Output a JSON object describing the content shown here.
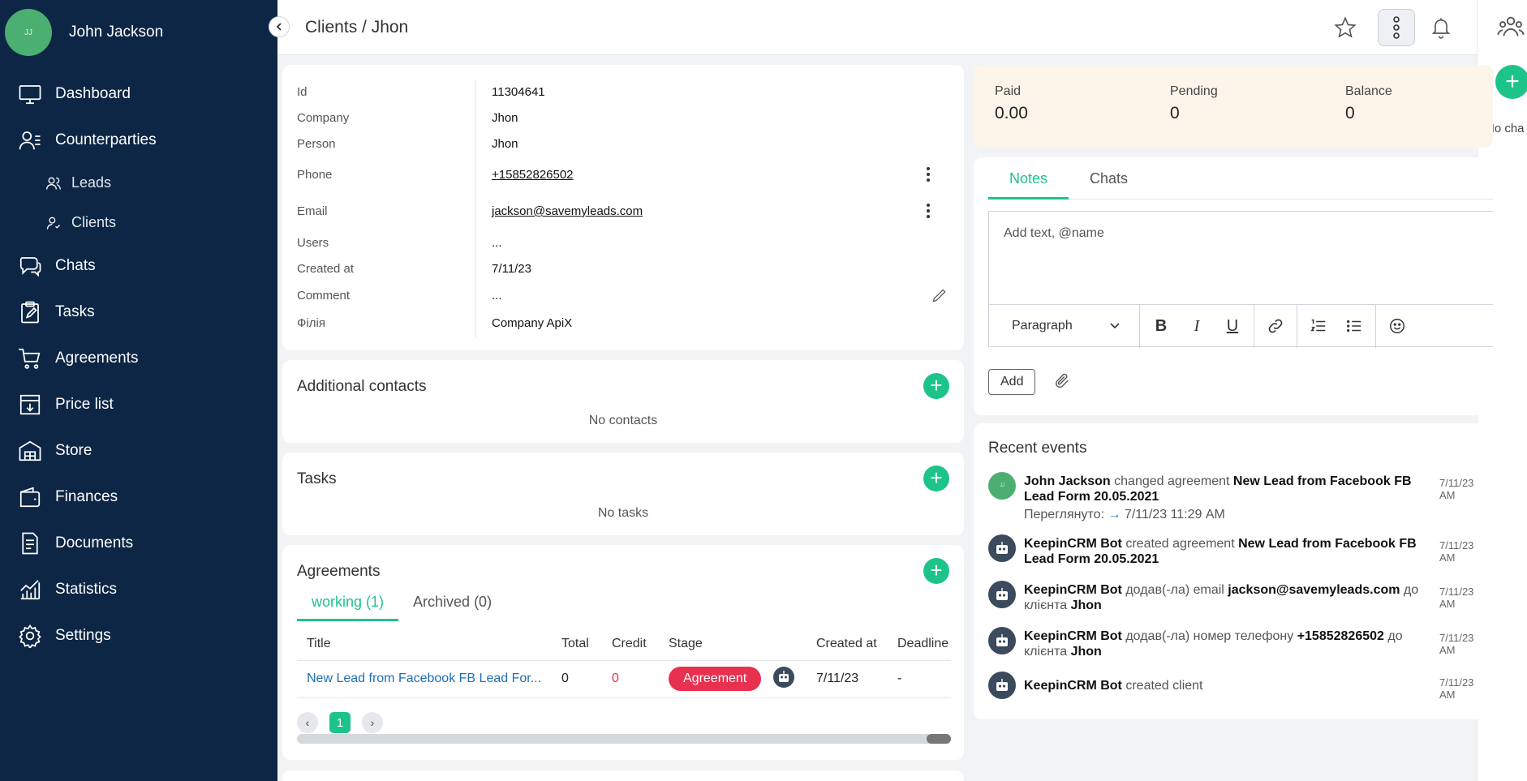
{
  "user": {
    "initials": "JJ",
    "name": "John Jackson"
  },
  "nav": [
    {
      "label": "Dashboard",
      "icon": "monitor-icon"
    },
    {
      "label": "Counterparties",
      "icon": "contacts-icon"
    },
    {
      "label": "Leads",
      "icon": "users-icon",
      "sub": true
    },
    {
      "label": "Clients",
      "icon": "user-icon",
      "sub": true
    },
    {
      "label": "Chats",
      "icon": "chat-icon"
    },
    {
      "label": "Tasks",
      "icon": "clipboard-icon"
    },
    {
      "label": "Agreements",
      "icon": "cart-icon"
    },
    {
      "label": "Price list",
      "icon": "price-list-icon"
    },
    {
      "label": "Store",
      "icon": "store-icon"
    },
    {
      "label": "Finances",
      "icon": "wallet-icon"
    },
    {
      "label": "Documents",
      "icon": "document-icon"
    },
    {
      "label": "Statistics",
      "icon": "statistics-icon"
    },
    {
      "label": "Settings",
      "icon": "gear-icon"
    }
  ],
  "header": {
    "title": "Clients / Jhon"
  },
  "info": {
    "id_label": "Id",
    "id": "11304641",
    "company_label": "Company",
    "company": "Jhon",
    "person_label": "Person",
    "person": "Jhon",
    "phone_label": "Phone",
    "phone": "+15852826502",
    "email_label": "Email",
    "email": "jackson@savemyleads.com",
    "users_label": "Users",
    "users": "...",
    "created_label": "Created at",
    "created": "7/11/23",
    "comment_label": "Comment",
    "comment": "...",
    "branch_label": "Філія",
    "branch": "Company ApiX"
  },
  "additional_contacts": {
    "title": "Additional contacts",
    "empty": "No contacts"
  },
  "tasks": {
    "title": "Tasks",
    "empty": "No tasks"
  },
  "agreements": {
    "title": "Agreements",
    "tab_working": "working (1)",
    "tab_archived": "Archived (0)",
    "columns": [
      "Title",
      "Total",
      "Credit",
      "Stage",
      "",
      "Created at",
      "Deadline"
    ],
    "rows": [
      {
        "title": "New Lead from Facebook FB Lead For...",
        "total": "0",
        "credit": "0",
        "stage": "Agreement",
        "created": "7/11/23",
        "deadline": "-"
      }
    ],
    "page": "1"
  },
  "balance": {
    "paid_label": "Paid",
    "paid": "0.00",
    "pending_label": "Pending",
    "pending": "0",
    "balance_label": "Balance",
    "balance": "0"
  },
  "notes": {
    "tab_notes": "Notes",
    "tab_chats": "Chats",
    "placeholder": "Add text, @name",
    "paragraph": "Paragraph",
    "add": "Add"
  },
  "events": {
    "title": "Recent events",
    "items": [
      {
        "actor": "John Jackson",
        "action": " changed agreement ",
        "target": "New Lead from Facebook FB Lead Form 20.05.2021",
        "time": "7/11/23 AM",
        "seen_label": "Переглянуто:",
        "seen_time": "7/11/23 11:29 AM"
      },
      {
        "actor": "KeepinCRM Bot",
        "action": " created agreement ",
        "target": "New Lead from Facebook FB Lead Form 20.05.2021",
        "time": "7/11/23 AM"
      },
      {
        "actor": "KeepinCRM Bot",
        "action": " додав(-ла) email ",
        "target": "jackson@savemyleads.com",
        "suffix": " до клієнта ",
        "suffix_target": "Jhon",
        "time": "7/11/23 AM"
      },
      {
        "actor": "KeepinCRM Bot",
        "action": " додав(-ла) номер телефону ",
        "target": "+15852826502",
        "suffix": " до клієнта ",
        "suffix_target": "Jhon",
        "time": "7/11/23 AM"
      },
      {
        "actor": "KeepinCRM Bot",
        "action": " created client",
        "time": "7/11/23 AM"
      }
    ]
  },
  "rail": {
    "text": "No cha"
  },
  "colors": {
    "sidebar": "#0d2645",
    "accent": "#1dc48a",
    "stage": "#e8304f",
    "balance_bg": "#fdf5ea"
  }
}
